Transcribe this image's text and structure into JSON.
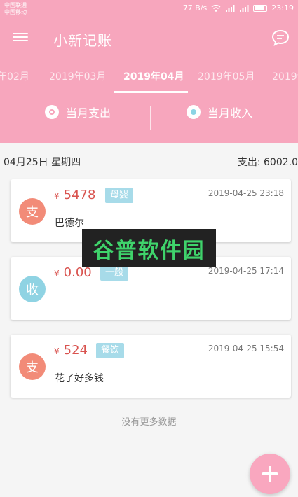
{
  "status": {
    "carrier1": "中国联通",
    "carrier2": "中国移动",
    "speed": "77 B/s",
    "time": "23:19"
  },
  "app": {
    "title": "小新记账"
  },
  "months": [
    "年02月",
    "2019年03月",
    "2019年04月",
    "2019年05月",
    "2019年"
  ],
  "active_month": "2019年04月",
  "summary": {
    "expense_label": "当月支出",
    "income_label": "当月收入"
  },
  "day": {
    "date": "04月25日 星期四",
    "total": "支出: 6002.0"
  },
  "records": [
    {
      "type": "支",
      "currency": "¥",
      "amount": "5478",
      "category": "母婴",
      "time": "2019-04-25 23:18",
      "note": "巴德尔"
    },
    {
      "type": "收",
      "currency": "¥",
      "amount": "0.00",
      "category": "一般",
      "time": "2019-04-25 17:14",
      "note": ""
    },
    {
      "type": "支",
      "currency": "¥",
      "amount": "524",
      "category": "餐饮",
      "time": "2019-04-25 15:54",
      "note": "花了好多钱"
    }
  ],
  "footer": {
    "no_more": "没有更多数据"
  },
  "watermark": "谷普软件园",
  "colors": {
    "primary": "#f7a6bd",
    "expense_avatar": "#f28b78",
    "income_avatar": "#8fd3e3",
    "amount": "#d9534f",
    "tag": "#a7dbe9"
  },
  "icons": {
    "menu": "menu-icon",
    "message": "message-icon",
    "add": "add-icon"
  }
}
